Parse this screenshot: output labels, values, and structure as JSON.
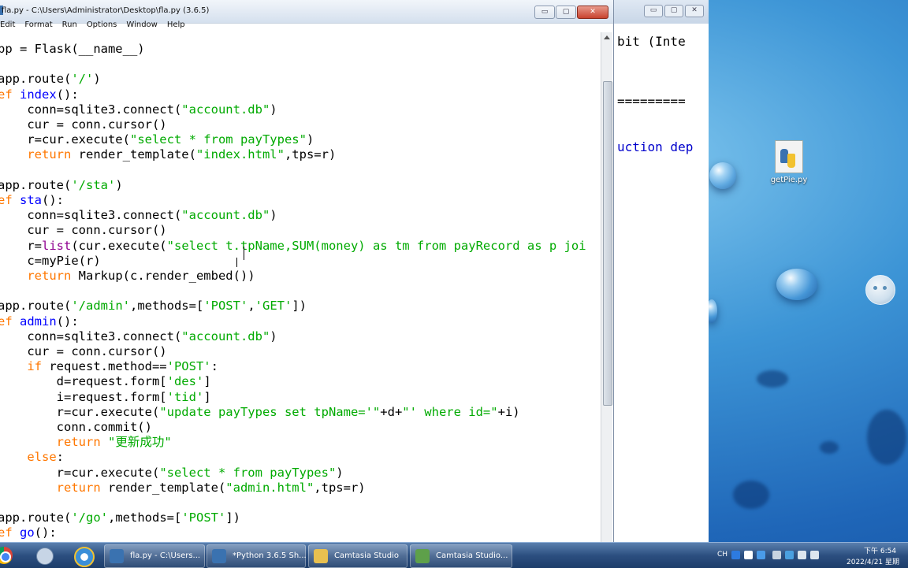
{
  "editor": {
    "title": "fla.py - C:\\Users\\Administrator\\Desktop\\fla.py (3.6.5)",
    "menu": [
      "Edit",
      "Format",
      "Run",
      "Options",
      "Window",
      "Help"
    ],
    "controls": {
      "minimize": "▭",
      "maximize": "▢",
      "close": "✕"
    }
  },
  "code_lines": [
    {
      "tokens": [
        {
          "c": "",
          "t": "pp = Flask(__name__)"
        }
      ]
    },
    {
      "tokens": [
        {
          "c": "",
          "t": ""
        }
      ]
    },
    {
      "tokens": [
        {
          "c": "",
          "t": "app.route("
        },
        {
          "c": "st",
          "t": "'/'"
        },
        {
          "c": "",
          "t": ")"
        }
      ]
    },
    {
      "tokens": [
        {
          "c": "kw",
          "t": "ef "
        },
        {
          "c": "df",
          "t": "index"
        },
        {
          "c": "",
          "t": "():"
        }
      ]
    },
    {
      "tokens": [
        {
          "c": "",
          "t": "    conn=sqlite3.connect("
        },
        {
          "c": "st",
          "t": "\"account.db\""
        },
        {
          "c": "",
          "t": ")"
        }
      ]
    },
    {
      "tokens": [
        {
          "c": "",
          "t": "    cur = conn.cursor()"
        }
      ]
    },
    {
      "tokens": [
        {
          "c": "",
          "t": "    r=cur.execute("
        },
        {
          "c": "st",
          "t": "\"select * from payTypes\""
        },
        {
          "c": "",
          "t": ")"
        }
      ]
    },
    {
      "tokens": [
        {
          "c": "kw",
          "t": "    return"
        },
        {
          "c": "",
          "t": " render_template("
        },
        {
          "c": "st",
          "t": "\"index.html\""
        },
        {
          "c": "",
          "t": ",tps=r)"
        }
      ]
    },
    {
      "tokens": [
        {
          "c": "",
          "t": ""
        }
      ]
    },
    {
      "tokens": [
        {
          "c": "",
          "t": "app.route("
        },
        {
          "c": "st",
          "t": "'/sta'"
        },
        {
          "c": "",
          "t": ")"
        }
      ]
    },
    {
      "tokens": [
        {
          "c": "kw",
          "t": "ef "
        },
        {
          "c": "df",
          "t": "sta"
        },
        {
          "c": "",
          "t": "():"
        }
      ]
    },
    {
      "tokens": [
        {
          "c": "",
          "t": "    conn=sqlite3.connect("
        },
        {
          "c": "st",
          "t": "\"account.db\""
        },
        {
          "c": "",
          "t": ")"
        }
      ]
    },
    {
      "tokens": [
        {
          "c": "",
          "t": "    cur = conn.cursor()"
        }
      ]
    },
    {
      "tokens": [
        {
          "c": "",
          "t": "    r="
        },
        {
          "c": "bi",
          "t": "list"
        },
        {
          "c": "",
          "t": "(cur.execute("
        },
        {
          "c": "st",
          "t": "\"select t.tpName,SUM(money) as tm from payRecord as p joi"
        }
      ]
    },
    {
      "tokens": [
        {
          "c": "",
          "t": "    c=myPie(r)"
        }
      ]
    },
    {
      "tokens": [
        {
          "c": "kw",
          "t": "    return"
        },
        {
          "c": "",
          "t": " Markup(c.render_embed())"
        }
      ]
    },
    {
      "tokens": [
        {
          "c": "",
          "t": ""
        }
      ]
    },
    {
      "tokens": [
        {
          "c": "",
          "t": "app.route("
        },
        {
          "c": "st",
          "t": "'/admin'"
        },
        {
          "c": "",
          "t": ",methods=["
        },
        {
          "c": "st",
          "t": "'POST'"
        },
        {
          "c": "",
          "t": ","
        },
        {
          "c": "st",
          "t": "'GET'"
        },
        {
          "c": "",
          "t": "])"
        }
      ]
    },
    {
      "tokens": [
        {
          "c": "kw",
          "t": "ef "
        },
        {
          "c": "df",
          "t": "admin"
        },
        {
          "c": "",
          "t": "():"
        }
      ]
    },
    {
      "tokens": [
        {
          "c": "",
          "t": "    conn=sqlite3.connect("
        },
        {
          "c": "st",
          "t": "\"account.db\""
        },
        {
          "c": "",
          "t": ")"
        }
      ]
    },
    {
      "tokens": [
        {
          "c": "",
          "t": "    cur = conn.cursor()"
        }
      ]
    },
    {
      "tokens": [
        {
          "c": "kw",
          "t": "    if"
        },
        {
          "c": "",
          "t": " request.method=="
        },
        {
          "c": "st",
          "t": "'POST'"
        },
        {
          "c": "",
          "t": ":"
        }
      ]
    },
    {
      "tokens": [
        {
          "c": "",
          "t": "        d=request.form["
        },
        {
          "c": "st",
          "t": "'des'"
        },
        {
          "c": "",
          "t": "]"
        }
      ]
    },
    {
      "tokens": [
        {
          "c": "",
          "t": "        i=request.form["
        },
        {
          "c": "st",
          "t": "'tid'"
        },
        {
          "c": "",
          "t": "]"
        }
      ]
    },
    {
      "tokens": [
        {
          "c": "",
          "t": "        r=cur.execute("
        },
        {
          "c": "st",
          "t": "\"update payTypes set tpName='\""
        },
        {
          "c": "",
          "t": "+d+"
        },
        {
          "c": "st",
          "t": "\"' where id=\""
        },
        {
          "c": "",
          "t": "+i)"
        }
      ]
    },
    {
      "tokens": [
        {
          "c": "",
          "t": "        conn.commit()"
        }
      ]
    },
    {
      "tokens": [
        {
          "c": "kw",
          "t": "        return"
        },
        {
          "c": "",
          "t": " "
        },
        {
          "c": "st",
          "t": "\"更新成功\""
        }
      ]
    },
    {
      "tokens": [
        {
          "c": "kw",
          "t": "    else"
        },
        {
          "c": "",
          "t": ":"
        }
      ]
    },
    {
      "tokens": [
        {
          "c": "",
          "t": "        r=cur.execute("
        },
        {
          "c": "st",
          "t": "\"select * from payTypes\""
        },
        {
          "c": "",
          "t": ")"
        }
      ]
    },
    {
      "tokens": [
        {
          "c": "kw",
          "t": "        return"
        },
        {
          "c": "",
          "t": " render_template("
        },
        {
          "c": "st",
          "t": "\"admin.html\""
        },
        {
          "c": "",
          "t": ",tps=r)"
        }
      ]
    },
    {
      "tokens": [
        {
          "c": "",
          "t": ""
        }
      ]
    },
    {
      "tokens": [
        {
          "c": "",
          "t": "app.route("
        },
        {
          "c": "st",
          "t": "'/go'"
        },
        {
          "c": "",
          "t": ",methods=["
        },
        {
          "c": "st",
          "t": "'POST'"
        },
        {
          "c": "",
          "t": "])"
        }
      ]
    },
    {
      "tokens": [
        {
          "c": "kw",
          "t": "ef "
        },
        {
          "c": "df",
          "t": "go"
        },
        {
          "c": "",
          "t": "():"
        }
      ]
    }
  ],
  "shell": {
    "lines": [
      {
        "text": "bit (Inte",
        "color": "#000000"
      },
      {
        "text": "=========",
        "color": "#000000"
      },
      {
        "text": "uction dep",
        "color": "#0000cc"
      }
    ]
  },
  "desktop": {
    "icon_label": "getPie.py"
  },
  "taskbar": {
    "items": [
      {
        "label": "fla.py - C:\\Users...",
        "icon_color": "#3a72b0"
      },
      {
        "label": "*Python 3.6.5 Sh...",
        "icon_color": "#3a72b0"
      },
      {
        "label": "Camtasia Studio",
        "icon_color": "#e8c050"
      },
      {
        "label": "Camtasia Studio...",
        "icon_color": "#5ea04a"
      }
    ],
    "tray": {
      "lang": "CH",
      "time": "下午 6:54",
      "date": "2022/4/21 星期"
    }
  }
}
